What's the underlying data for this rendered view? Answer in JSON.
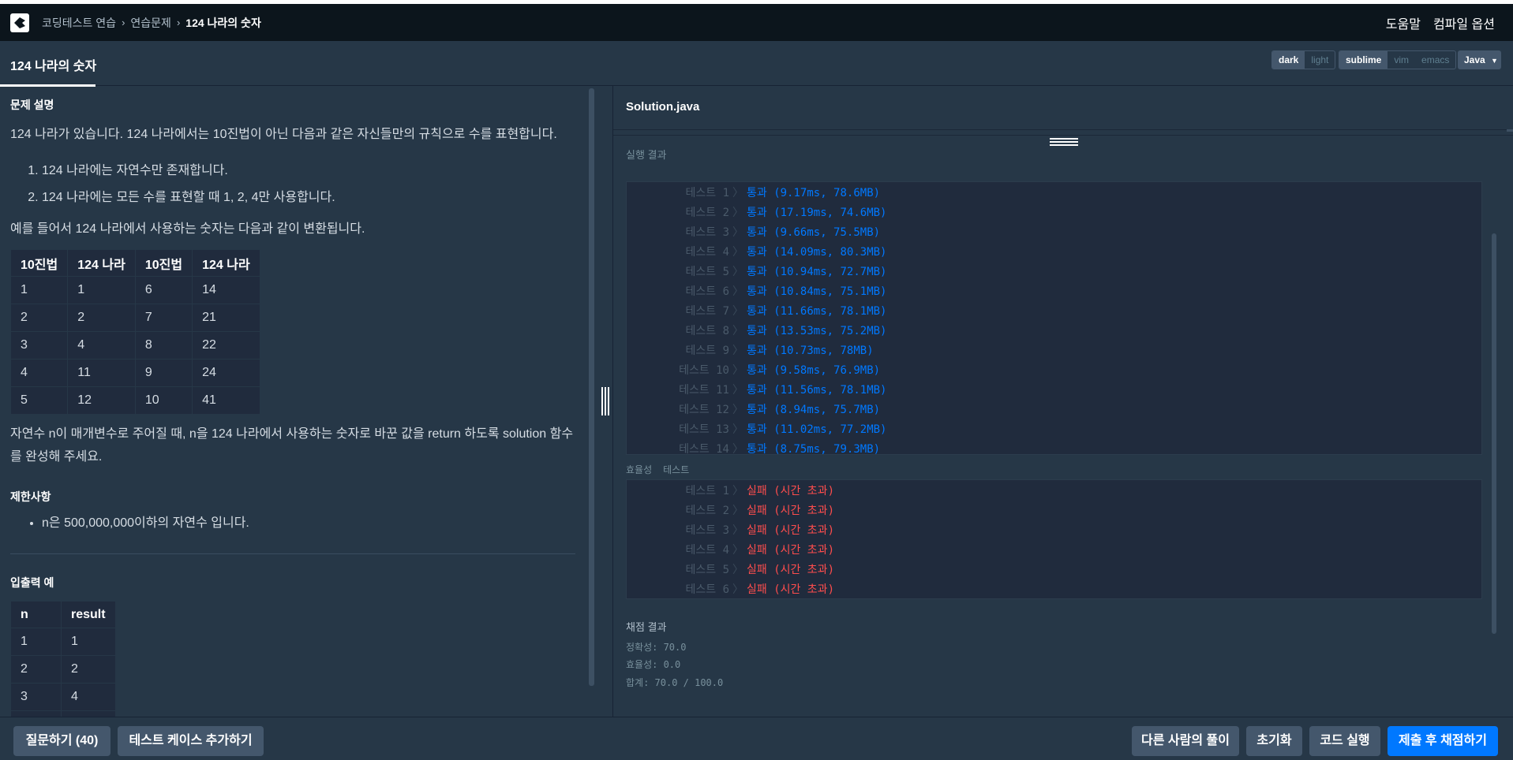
{
  "navbar": {
    "breadcrumb": [
      "코딩테스트 연습",
      "연습문제",
      "124 나라의 숫자"
    ],
    "help_label": "도움말",
    "compile_options_label": "컴파일 옵션"
  },
  "tab": {
    "title": "124 나라의 숫자"
  },
  "editor_options": {
    "themes": [
      "dark",
      "light"
    ],
    "theme_selected": "dark",
    "keymaps": [
      "sublime",
      "vim",
      "emacs"
    ],
    "keymap_selected": "sublime",
    "language": "Java"
  },
  "problem": {
    "section_title": "문제 설명",
    "intro": "124 나라가 있습니다. 124 나라에서는 10진법이 아닌 다음과 같은 자신들만의 규칙으로 수를 표현합니다.",
    "rules": [
      "124 나라에는 자연수만 존재합니다.",
      "124 나라에는 모든 수를 표현할 때 1, 2, 4만 사용합니다."
    ],
    "example_intro": "예를 들어서 124 나라에서 사용하는 숫자는 다음과 같이 변환됩니다.",
    "conversion_table": {
      "headers": [
        "10진법",
        "124 나라",
        "10진법",
        "124 나라"
      ],
      "rows": [
        [
          "1",
          "1",
          "6",
          "14"
        ],
        [
          "2",
          "2",
          "7",
          "21"
        ],
        [
          "3",
          "4",
          "8",
          "22"
        ],
        [
          "4",
          "11",
          "9",
          "24"
        ],
        [
          "5",
          "12",
          "10",
          "41"
        ]
      ]
    },
    "task": "자연수 n이 매개변수로 주어질 때, n을 124 나라에서 사용하는 숫자로 바꾼 값을 return 하도록 solution 함수를 완성해 주세요.",
    "constraints_title": "제한사항",
    "constraints": [
      "n은 500,000,000이하의 자연수 입니다."
    ],
    "io_title": "입출력 예",
    "io_table": {
      "headers": [
        "n",
        "result"
      ],
      "rows": [
        [
          "1",
          "1"
        ],
        [
          "2",
          "2"
        ],
        [
          "3",
          "4"
        ]
      ]
    }
  },
  "editor": {
    "filename": "Solution.java",
    "result_label": "실행 결과"
  },
  "accuracy_tests": [
    {
      "name": "테스트 1",
      "result": "통과 (9.17ms, 78.6MB)"
    },
    {
      "name": "테스트 2",
      "result": "통과 (17.19ms, 74.6MB)"
    },
    {
      "name": "테스트 3",
      "result": "통과 (9.66ms, 75.5MB)"
    },
    {
      "name": "테스트 4",
      "result": "통과 (14.09ms, 80.3MB)"
    },
    {
      "name": "테스트 5",
      "result": "통과 (10.94ms, 72.7MB)"
    },
    {
      "name": "테스트 6",
      "result": "통과 (10.84ms, 75.1MB)"
    },
    {
      "name": "테스트 7",
      "result": "통과 (11.66ms, 78.1MB)"
    },
    {
      "name": "테스트 8",
      "result": "통과 (13.53ms, 75.2MB)"
    },
    {
      "name": "테스트 9",
      "result": "통과 (10.73ms, 78MB)"
    },
    {
      "name": "테스트 10",
      "result": "통과 (9.58ms, 76.9MB)"
    },
    {
      "name": "테스트 11",
      "result": "통과 (11.56ms, 78.1MB)"
    },
    {
      "name": "테스트 12",
      "result": "통과 (8.94ms, 75.7MB)"
    },
    {
      "name": "테스트 13",
      "result": "통과 (11.02ms, 77.2MB)"
    },
    {
      "name": "테스트 14",
      "result": "통과 (8.75ms, 79.3MB)"
    }
  ],
  "efficiency_label": {
    "left": "효율성",
    "right": "테스트"
  },
  "efficiency_tests": [
    {
      "name": "테스트 1",
      "result": "실패 (시간 초과)"
    },
    {
      "name": "테스트 2",
      "result": "실패 (시간 초과)"
    },
    {
      "name": "테스트 3",
      "result": "실패 (시간 초과)"
    },
    {
      "name": "테스트 4",
      "result": "실패 (시간 초과)"
    },
    {
      "name": "테스트 5",
      "result": "실패 (시간 초과)"
    },
    {
      "name": "테스트 6",
      "result": "실패 (시간 초과)"
    }
  ],
  "grading": {
    "title": "채점 결과",
    "accuracy": "정확성: 70.0",
    "efficiency": "효율성: 0.0",
    "total": "합계: 70.0 / 100.0"
  },
  "footer": {
    "ask_label": "질문하기 (40)",
    "add_testcase_label": "테스트 케이스 추가하기",
    "others_solution_label": "다른 사람의 풀이",
    "reset_label": "초기화",
    "run_label": "코드 실행",
    "submit_label": "제출 후 채점하기"
  },
  "colors": {
    "background": "#263747",
    "navbar": "#0c151c",
    "pass": "#0078ff",
    "fail": "#ff4d4d",
    "primary_button": "#0078ff"
  }
}
